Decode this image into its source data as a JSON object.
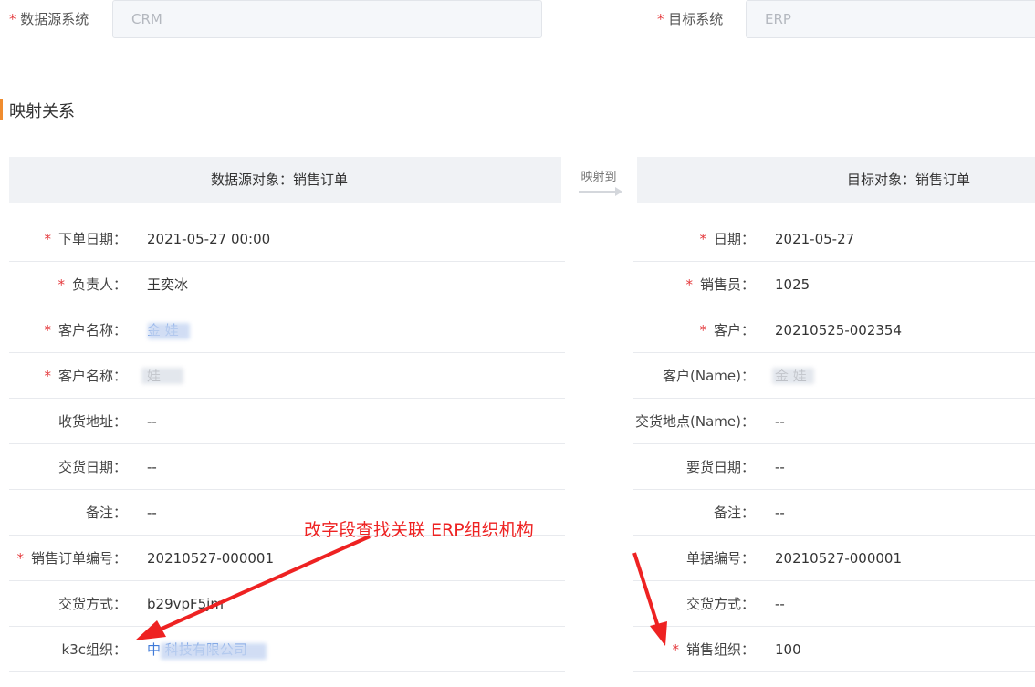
{
  "systems": {
    "source": {
      "label": "数据源系统",
      "value": "CRM"
    },
    "target": {
      "label": "目标系统",
      "value": "ERP"
    }
  },
  "section_title": "映射关系",
  "mapping": {
    "source_header": "数据源对象：销售订单",
    "arrow_label": "映射到",
    "target_header": "目标对象：销售订单"
  },
  "source_rows": [
    {
      "label": "下单日期：",
      "value": "2021-05-27 00:00",
      "required": true
    },
    {
      "label": "负责人：",
      "value": "王奕冰",
      "required": true
    },
    {
      "label": "客户名称：",
      "value": "金 娃",
      "required": true,
      "link": true
    },
    {
      "label": "客户名称：",
      "value": "娃",
      "required": true
    },
    {
      "label": "收货地址：",
      "value": "--",
      "required": false
    },
    {
      "label": "交货日期：",
      "value": "--",
      "required": false
    },
    {
      "label": "备注：",
      "value": "--",
      "required": false
    },
    {
      "label": "销售订单编号：",
      "value": "20210527-000001",
      "required": true
    },
    {
      "label": "交货方式：",
      "value": "b29vpF5jm",
      "required": false
    },
    {
      "label": "k3c组织：",
      "value": "中 科技有限公司",
      "required": false,
      "link": true
    }
  ],
  "target_rows": [
    {
      "label": "日期：",
      "value": "2021-05-27",
      "required": true
    },
    {
      "label": "销售员：",
      "value": "1025",
      "required": true
    },
    {
      "label": "客户：",
      "value": "20210525-002354",
      "required": true
    },
    {
      "label": "客户(Name)：",
      "value": "金 娃",
      "required": false
    },
    {
      "label": "交货地点(Name)：",
      "value": "--",
      "required": false
    },
    {
      "label": "要货日期：",
      "value": "--",
      "required": false
    },
    {
      "label": "备注：",
      "value": "--",
      "required": false
    },
    {
      "label": "单据编号：",
      "value": "20210527-000001",
      "required": false
    },
    {
      "label": "交货方式：",
      "value": "--",
      "required": false
    },
    {
      "label": "销售组织：",
      "value": "100",
      "required": true
    }
  ],
  "annotation": "改字段查找关联 ERP组织机构",
  "colors": {
    "required": "#e4393c",
    "link": "#3f7ad8",
    "annotation": "#ee2222"
  }
}
